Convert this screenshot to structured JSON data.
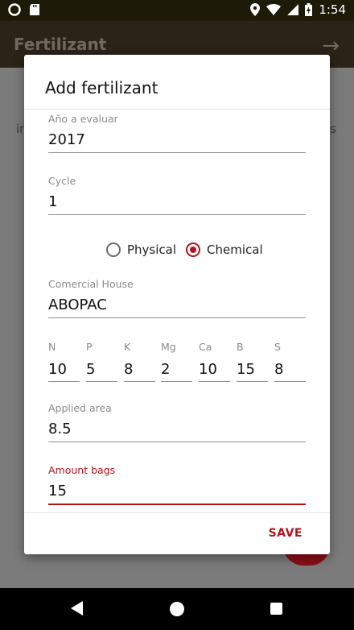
{
  "status_bar": {
    "time": "1:54"
  },
  "app_bar": {
    "title": "Fertilizant",
    "forward_icon": "arrow-right-icon"
  },
  "background": {
    "left_fragment": "in",
    "right_fragment": "s"
  },
  "dialog": {
    "title": "Add fertilizant",
    "fields": {
      "year": {
        "label": "Año a evaluar",
        "value": "2017"
      },
      "cycle": {
        "label": "Cycle",
        "value": "1"
      },
      "commercial_house": {
        "label": "Comercial House",
        "value": "ABOPAC"
      },
      "applied_area": {
        "label": "Applied area",
        "value": "8.5"
      },
      "amount_bags": {
        "label": "Amount bags",
        "value": "15"
      }
    },
    "type": {
      "options": [
        "Physical",
        "Chemical"
      ],
      "selected": "Chemical"
    },
    "nutrients": [
      {
        "label": "N",
        "value": "10"
      },
      {
        "label": "P",
        "value": "5"
      },
      {
        "label": "K",
        "value": "8"
      },
      {
        "label": "Mg",
        "value": "2"
      },
      {
        "label": "Ca",
        "value": "10"
      },
      {
        "label": "B",
        "value": "15"
      },
      {
        "label": "S",
        "value": "8"
      }
    ],
    "save_label": "SAVE"
  },
  "colors": {
    "accent": "#b3121e",
    "status_bar": "#1e1a08"
  }
}
